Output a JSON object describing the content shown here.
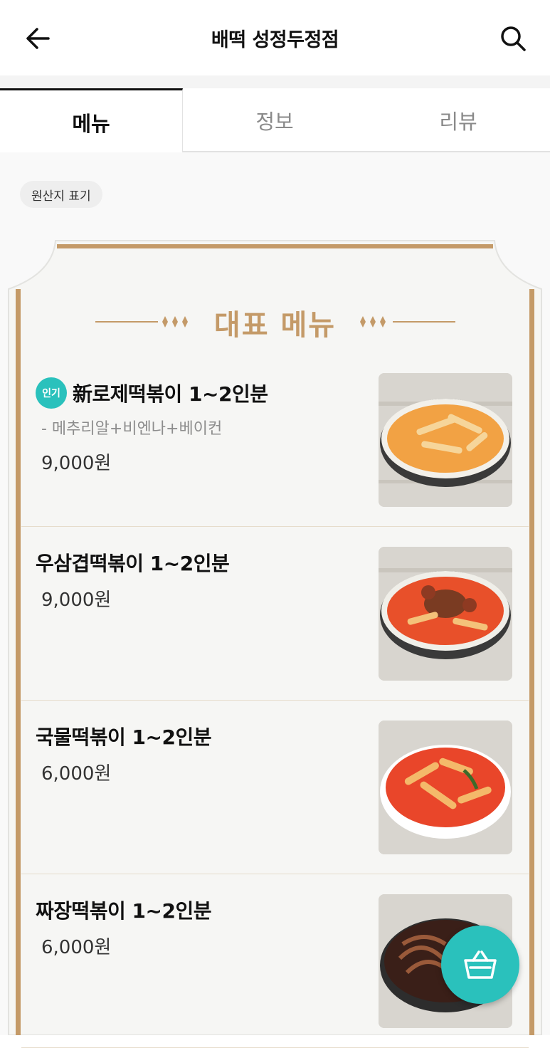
{
  "header": {
    "title": "배떡 성정두정점",
    "back_icon": "arrow-left-icon",
    "search_icon": "search-icon"
  },
  "tabs": [
    {
      "label": "메뉴",
      "active": true
    },
    {
      "label": "정보",
      "active": false
    },
    {
      "label": "리뷰",
      "active": false
    }
  ],
  "origin_chip": "원산지 표기",
  "board": {
    "title": "대표 메뉴",
    "ornament_icon": "diamond-ornament-icon"
  },
  "menu": [
    {
      "badge": "인기",
      "name": "新로제떡볶이 1~2인분",
      "description": "- 메추리알+비엔나+베이컨",
      "price": "9,000원",
      "image_icon": "rose-tteokbokki-image"
    },
    {
      "name": "우삼겹떡볶이 1~2인분",
      "price": "9,000원",
      "image_icon": "beef-tteokbokki-image"
    },
    {
      "name": "국물떡볶이 1~2인분",
      "price": "6,000원",
      "image_icon": "soup-tteokbokki-image"
    },
    {
      "name": "짜장떡볶이 1~2인분",
      "price": "6,000원",
      "image_icon": "jjajang-tteokbokki-image"
    }
  ],
  "cart_icon": "basket-icon",
  "colors": {
    "accent": "#2ac1bc",
    "board_gold": "#c49a68"
  }
}
